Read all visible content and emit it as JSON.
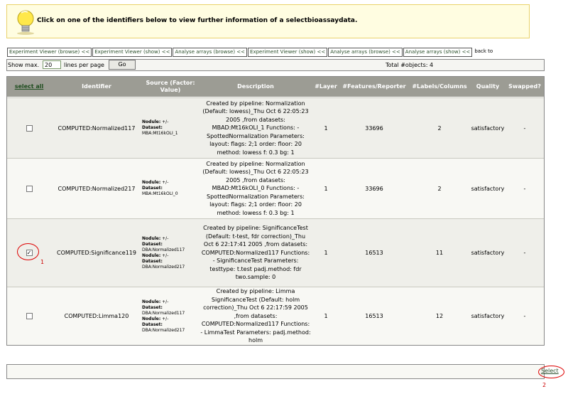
{
  "info": {
    "icon": "lightbulb-icon",
    "text": "Click on one of the identifiers below to view further information of a selectbioassaydata."
  },
  "breadcrumbs": [
    "Experiment Viewer (browse) <<",
    "Experiment Viewer (show) <<",
    "Analyse arrays (browse) <<",
    "Experiment Viewer (show) <<",
    "Analyse arrays (browse) <<",
    "Analyse arrays (show) <<"
  ],
  "breadcrumb_tail": "back to",
  "pager": {
    "show_label": "Show max.",
    "show_value": "20",
    "lines_label": "lines per page",
    "go_label": "Go",
    "total": "Total #objects: 4"
  },
  "table": {
    "headers": {
      "select_all": "select all",
      "identifier": "Identifier",
      "source": "Source (Factor: Value)",
      "description": "Description",
      "layer": "#Layer",
      "features": "#Features/Reporter",
      "labels": "#Labels/Columns",
      "quality": "Quality",
      "swapped": "Swapped?"
    },
    "rows": [
      {
        "checked": false,
        "identifier": "COMPUTED:Normalized117",
        "source": [
          {
            "k": "Nodule:",
            "v": " +/-"
          },
          {
            "k": "Dataset:",
            "v": ""
          },
          {
            "k": "",
            "v": "MBA:Mt16kOLI_1"
          }
        ],
        "description": "Created by pipeline: Normalization (Default: lowess)_Thu Oct 6 22:05:23 2005 ,from datasets: MBAD:Mt16kOLI_1 Functions: - SpottedNormalization Parameters: layout: flags: 2;1 order: floor: 20 method: lowess f: 0.3 bg: 1",
        "layer": "1",
        "features": "33696",
        "labels": "2",
        "quality": "satisfactory",
        "swapped": "-"
      },
      {
        "checked": false,
        "identifier": "COMPUTED:Normalized217",
        "source": [
          {
            "k": "Nodule:",
            "v": " +/-"
          },
          {
            "k": "Dataset:",
            "v": ""
          },
          {
            "k": "",
            "v": "MBA:Mt16kOLI_0"
          }
        ],
        "description": "Created by pipeline: Normalization (Default: lowess)_Thu Oct 6 22:05:23 2005 ,from datasets: MBAD:Mt16kOLI_0 Functions: - SpottedNormalization Parameters: layout: flags: 2;1 order: floor: 20 method: lowess f: 0.3 bg: 1",
        "layer": "1",
        "features": "33696",
        "labels": "2",
        "quality": "satisfactory",
        "swapped": "-"
      },
      {
        "checked": true,
        "identifier": "COMPUTED:Significance119",
        "source": [
          {
            "k": "Nodule:",
            "v": " +/-"
          },
          {
            "k": "Dataset:",
            "v": ""
          },
          {
            "k": "",
            "v": "DBA:Normalized117"
          },
          {
            "k": "Nodule:",
            "v": " +/-"
          },
          {
            "k": "Dataset:",
            "v": ""
          },
          {
            "k": "",
            "v": "DBA:Normalized217"
          }
        ],
        "description": "Created by pipeline: SignificanceTest (Default: t-test, fdr correction)_Thu Oct 6 22:17:41 2005 ,from datasets: COMPUTED:Normalized117 Functions: - SignificanceTest Parameters: testtype: t.test padj.method: fdr two.sample: 0",
        "layer": "1",
        "features": "16513",
        "labels": "11",
        "quality": "satisfactory",
        "swapped": "-"
      },
      {
        "checked": false,
        "identifier": "COMPUTED:Limma120",
        "source": [
          {
            "k": "Nodule:",
            "v": " +/-"
          },
          {
            "k": "Dataset:",
            "v": ""
          },
          {
            "k": "",
            "v": "DBA:Normalized117"
          },
          {
            "k": "Nodule:",
            "v": " +/-"
          },
          {
            "k": "Dataset:",
            "v": ""
          },
          {
            "k": "",
            "v": "DBA:Normalized217"
          }
        ],
        "description": "Created by pipeline: Limma SignificanceTest (Default: holm correction)_Thu Oct 6 22:17:59 2005 ,from datasets: COMPUTED:Normalized117 Functions: - LimmaTest Parameters: padj.method: holm",
        "layer": "1",
        "features": "16513",
        "labels": "12",
        "quality": "satisfactory",
        "swapped": "-"
      }
    ]
  },
  "annotations": {
    "one": "1",
    "two": "2"
  },
  "select_label": "Select",
  "colors": {
    "accent_link": "#2b4f2b",
    "header_bg": "#9c9c94",
    "annotation_red": "#d00000",
    "banner_bg": "#fffde1"
  }
}
